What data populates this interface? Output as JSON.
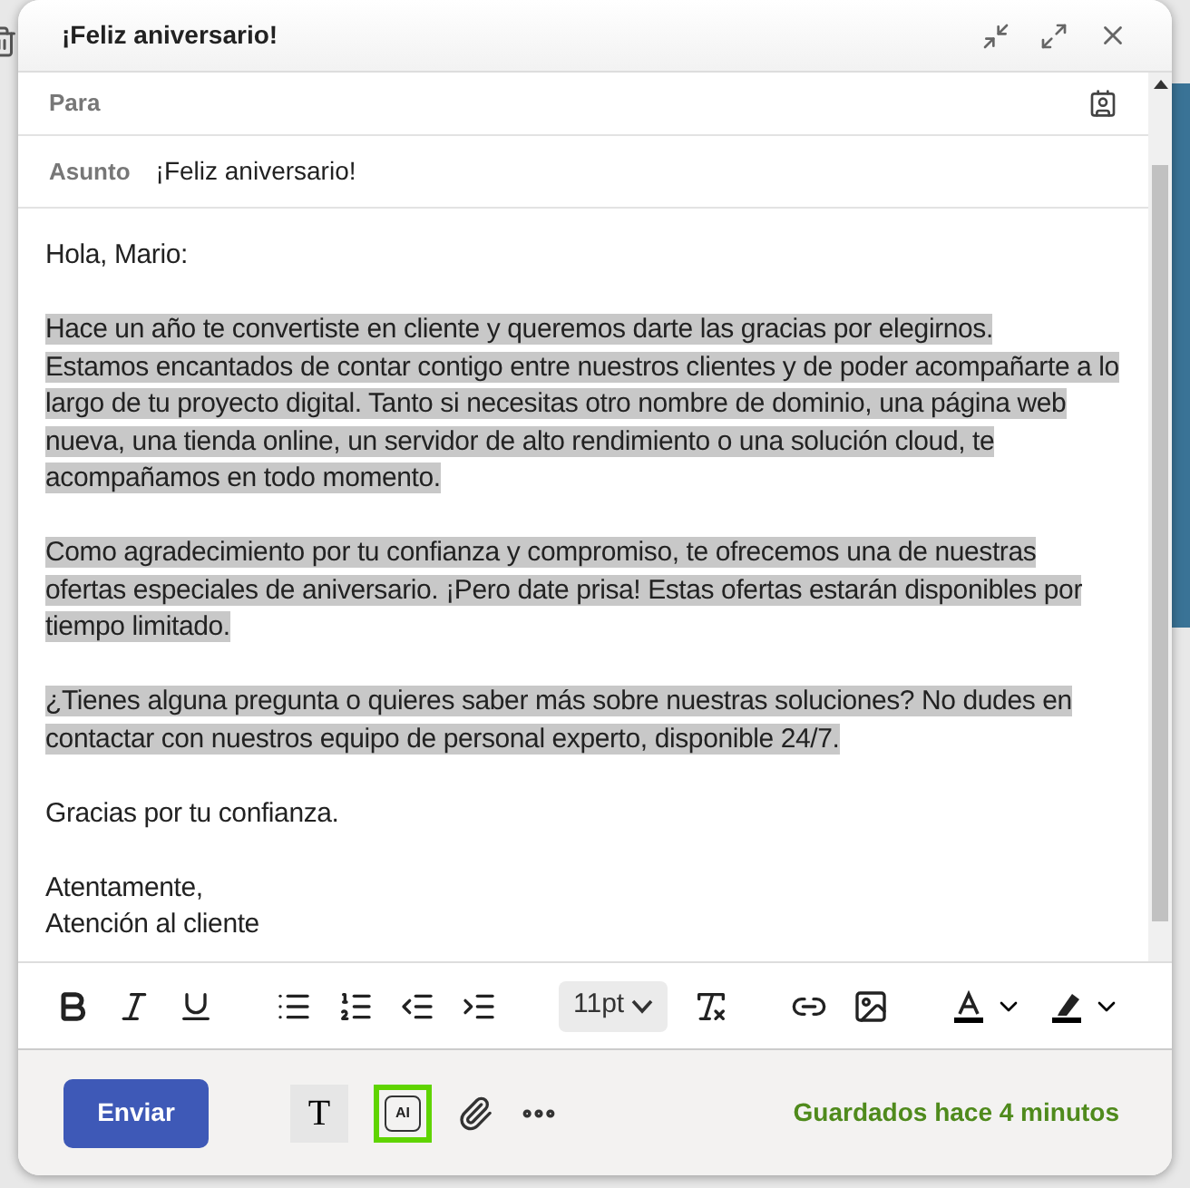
{
  "window": {
    "title": "¡Feliz aniversario!"
  },
  "to": {
    "label": "Para"
  },
  "subject": {
    "label": "Asunto",
    "value": "¡Feliz aniversario!"
  },
  "body": [
    {
      "text": "Hola, Mario:",
      "selected": false
    },
    {
      "text": "Hace un año te convertiste en cliente y queremos darte las gracias por elegirnos.\nEstamos encantados de contar contigo entre nuestros clientes y de poder acompañarte a lo largo de tu proyecto digital. Tanto si necesitas otro nombre de dominio, una página web nueva, una tienda online, un servidor de alto rendimiento o una solución cloud, te acompañamos en todo momento.",
      "selected": true
    },
    {
      "text": "Como agradecimiento por tu confianza y compromiso, te ofrecemos una de nuestras ofertas especiales de aniversario. ¡Pero date prisa! Estas ofertas estarán disponibles por tiempo limitado.",
      "selected": true
    },
    {
      "text": "¿Tienes alguna pregunta o quieres saber más sobre nuestras soluciones? No dudes en contactar con nuestros equipo de personal experto, disponible 24/7.",
      "selected": true
    },
    {
      "text": "Gracias por tu confianza.",
      "selected": false
    },
    {
      "text": "Atentamente,\nAtención al cliente",
      "selected": false
    }
  ],
  "toolbar": [
    {
      "kind": "bold"
    },
    {
      "kind": "italic"
    },
    {
      "kind": "underline"
    },
    {
      "kind": "bullets"
    },
    {
      "kind": "numbers"
    },
    {
      "kind": "outdent"
    },
    {
      "kind": "indent"
    },
    {
      "kind": "fontsize",
      "value": "11pt"
    },
    {
      "kind": "clear"
    },
    {
      "kind": "link"
    },
    {
      "kind": "image"
    },
    {
      "kind": "fontcolor"
    },
    {
      "kind": "highlight"
    }
  ],
  "footer": {
    "send": "Enviar",
    "tools": [
      {
        "kind": "text",
        "label": "T",
        "selected": true
      },
      {
        "kind": "ai",
        "label": "AI",
        "selected": true
      },
      {
        "kind": "attach",
        "selected": false
      },
      {
        "kind": "more",
        "selected": false
      }
    ],
    "status": "Guardados hace 4 minutos"
  }
}
